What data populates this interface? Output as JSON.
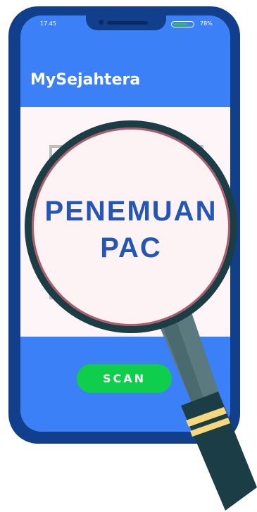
{
  "status_bar": {
    "time": "17.45",
    "battery_percent_label": "78%",
    "battery_level": 0.78,
    "battery_color": "#22c55e"
  },
  "app": {
    "title": "MySejahtera"
  },
  "scanner": {
    "heading_line1": "PENEMUAN",
    "heading_line2": "PAC"
  },
  "actions": {
    "scan_label": "SCAN"
  },
  "colors": {
    "phone_frame": "#123f8c",
    "screen": "#3b80f6",
    "content": "#fdf5f8",
    "scan_button": "#0fce4c",
    "heading_text": "#2356b5",
    "magnifier_rim": "#1b3d45"
  },
  "icons": [
    "magnifying-glass-icon",
    "camera-icon"
  ]
}
